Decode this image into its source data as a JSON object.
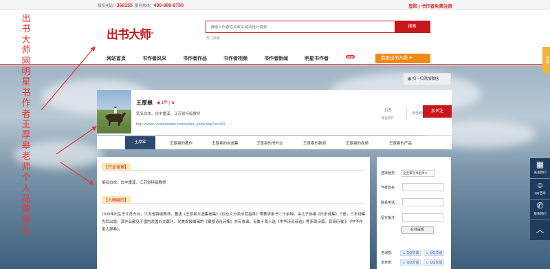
{
  "topbar": {
    "stock_label": "股权代码：",
    "stock_code": "368155",
    "hotline_label": "服务热线：",
    "hotline": "400-888-9750",
    "login": "登陆",
    "register": "书作者免费注册"
  },
  "header": {
    "logo": "出书大师",
    "search_placeholder": "请输入作者姓名或关键词进行搜索",
    "search_button": "搜索",
    "hot_search": "热门搜索：",
    "nav": [
      "网站首页",
      "书作者风采",
      "书作者作品",
      "书作者视频",
      "书作者新闻",
      "明星书作者"
    ],
    "nav_badge": "NEW",
    "cta": "我要出书万鼎"
  },
  "profile": {
    "scan_label": "扫一扫添加微信",
    "name": "王厚皋",
    "level": "1年",
    "description": "笔名白本、白丰雷溪，江苏省特级教师",
    "url": "http://www.chushudashi.com/writer_show.asp?id=362",
    "fans_count": "125",
    "fans_label": "粉丝排行",
    "favorite": "点击收藏",
    "follow": "加关注"
  },
  "tabs": [
    "王厚皋",
    "王厚皋的著作",
    "王厚皋的自选集",
    "王厚皋的书外交",
    "王厚皋的新闻",
    "王厚皋的视频",
    "王厚皋的产品"
  ],
  "content": {
    "section1_title": "【行业背景】",
    "section1_text": "笔名白本、白丰雷溪，江苏省特级教师",
    "section2_title": "【人物经历】",
    "section2_text": "1939年出生于江苏东台，江苏省特级教师。著述《王厚皋文选集卷集》《议论文分类示范指导》等教学用书二十余种。由儿子协编《白本诗集》三册，三本诗集先后出版。其作品散见于国内及国外文献刊，北美周报编辑的《聚璧诗社诗集》亦有收录。有数十首入选《中华诗词诗选》等多部诗篇。其简历收于《中华作家大辞典》。"
  },
  "form": {
    "field1_label": "选择服务:",
    "field1_value": "企业家写书出书",
    "field2_label": "作者姓名:",
    "field3_label": "联系电话:",
    "field4_label": "留言备注:",
    "submit": "在线提报",
    "consult_label": "咨询部:",
    "publish_label": "发表部:",
    "qq_label": "QQ交谈"
  },
  "side": {
    "tab": "分享",
    "wechat": "关注我们",
    "qq": "QQ咨询",
    "phone": "联系我们"
  },
  "annotation": "出书大师网明星书作者王厚皋老师个人品牌网站"
}
